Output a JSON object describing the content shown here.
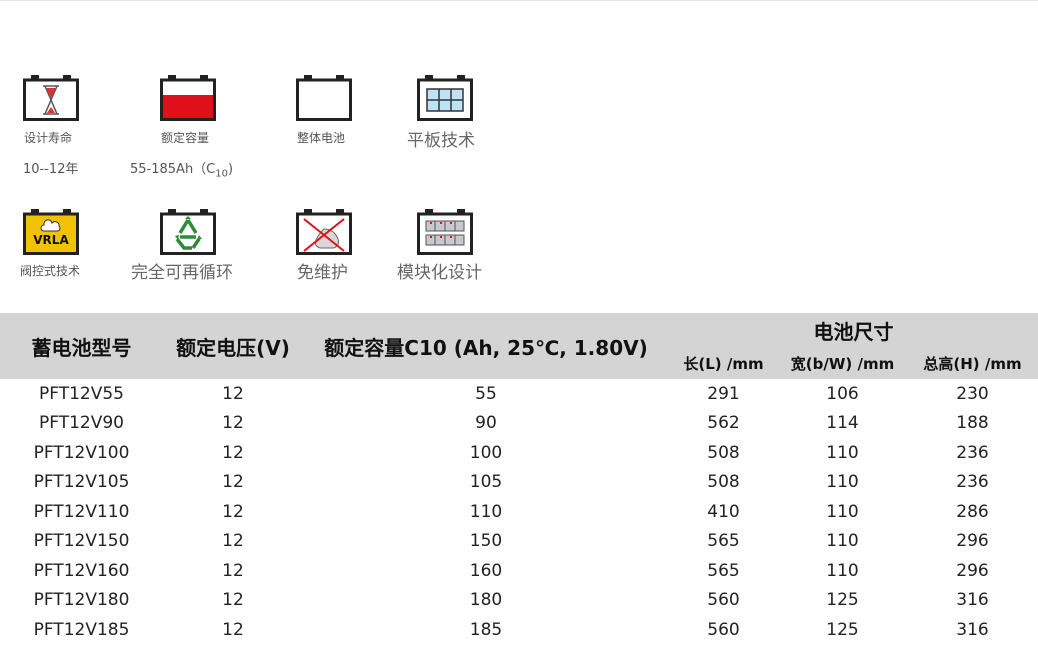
{
  "features": [
    {
      "icon": "hourglass-battery-icon",
      "label": "设计寿命",
      "value": "10--12年"
    },
    {
      "icon": "capacity-battery-icon",
      "label": "额定容量",
      "value_main": "55-185Ah（C",
      "value_sub": "10",
      "value_end": ")"
    },
    {
      "icon": "battery-outline-icon",
      "label": "整体电池"
    },
    {
      "icon": "flat-plate-battery-icon",
      "label": "平板技术"
    },
    {
      "icon": "vrla-battery-icon",
      "label": "阀控式技术",
      "badge": "VRLA"
    },
    {
      "icon": "recycle-battery-icon",
      "label": "完全可再循环"
    },
    {
      "icon": "maintenance-free-battery-icon",
      "label": "免维护"
    },
    {
      "icon": "modular-battery-icon",
      "label": "模块化设计"
    }
  ],
  "table": {
    "headers": {
      "model": "蓄电池型号",
      "voltage": "额定电压(V)",
      "capacity": "额定容量C10 (Ah, 25℃, 1.80V)",
      "dimensions": "电池尺寸",
      "length": "长(L) /mm",
      "width": "宽(b/W) /mm",
      "height": "总高(H) /mm"
    },
    "rows": [
      [
        "PFT12V55",
        "12",
        "55",
        "291",
        "106",
        "230"
      ],
      [
        "PFT12V90",
        "12",
        "90",
        "562",
        "114",
        "188"
      ],
      [
        "PFT12V100",
        "12",
        "100",
        "508",
        "110",
        "236"
      ],
      [
        "PFT12V105",
        "12",
        "105",
        "508",
        "110",
        "236"
      ],
      [
        "PFT12V110",
        "12",
        "110",
        "410",
        "110",
        "286"
      ],
      [
        "PFT12V150",
        "12",
        "150",
        "565",
        "110",
        "296"
      ],
      [
        "PFT12V160",
        "12",
        "160",
        "565",
        "110",
        "296"
      ],
      [
        "PFT12V180",
        "12",
        "180",
        "560",
        "125",
        "316"
      ],
      [
        "PFT12V185",
        "12",
        "185",
        "560",
        "125",
        "316"
      ]
    ]
  },
  "colors": {
    "header_bg": "#d4d4d4",
    "capacity_red": "#e0101a",
    "vrla_yellow": "#f2c200"
  }
}
